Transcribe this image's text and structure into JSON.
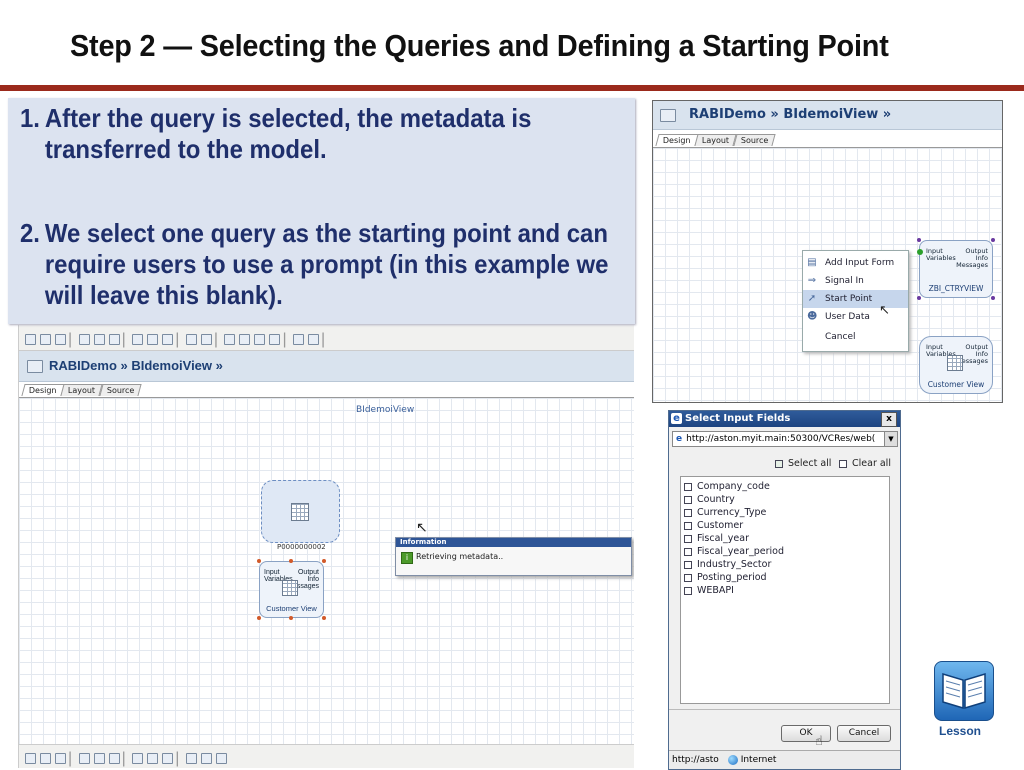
{
  "slide": {
    "title": "Step 2 — Selecting the Queries and Defining a Starting Point",
    "bullets": [
      {
        "num": "1.",
        "text": "After the query is selected, the metadata is transferred to the model."
      },
      {
        "num": "2.",
        "text": "We select one query as the starting point and can require users to use a prompt (in this example we will leave this blank)."
      }
    ],
    "lesson_label": "Lesson"
  },
  "main_window": {
    "breadcrumb": "RABIDemo » BIdemoiView »",
    "tabs": [
      "Design",
      "Layout",
      "Source"
    ],
    "canvas_title": "BIdemoiView",
    "node_label": "P0000000002",
    "query_node": {
      "ports_left": [
        "Input",
        "Variables"
      ],
      "ports_right": [
        "Output",
        "Info",
        "Messages"
      ],
      "label": "Customer View"
    },
    "info_popup": {
      "title": "Information",
      "message": "Retrieving metadata.."
    }
  },
  "context_window": {
    "breadcrumb": "RABIDemo » BIdemoiView »",
    "tabs": [
      "Design",
      "Layout",
      "Source"
    ],
    "menu": [
      {
        "label": "Add Input Form",
        "icon": "form-icon"
      },
      {
        "label": "Signal In",
        "icon": "signal-in-icon"
      },
      {
        "label": "Start Point",
        "icon": "start-point-icon",
        "highlighted": true
      },
      {
        "label": "User Data",
        "icon": "user-data-icon"
      },
      {
        "label": "Cancel",
        "icon": ""
      }
    ],
    "node_top": {
      "ports_left": [
        "Input",
        "Variables"
      ],
      "ports_right": [
        "Output",
        "Info",
        "Messages"
      ],
      "label": "ZBI_CTRYVIEW"
    },
    "node_bottom": {
      "ports_left": [
        "Input",
        "Variables"
      ],
      "ports_right": [
        "Output",
        "Info",
        "Messages"
      ],
      "label": "Customer View"
    }
  },
  "dialog": {
    "title": "Select Input Fields",
    "close": "x",
    "url": "http://aston.myit.main:50300/VCRes/web(",
    "select_all": "Select all",
    "clear_all": "Clear all",
    "fields": [
      "Company_code",
      "Country",
      "Currency_Type",
      "Customer",
      "Fiscal_year",
      "Fiscal_year_period",
      "Industry_Sector",
      "Posting_period",
      "WEBAPI"
    ],
    "ok": "OK",
    "cancel": "Cancel",
    "status_url": "http://asto",
    "status_zone": "Internet"
  }
}
